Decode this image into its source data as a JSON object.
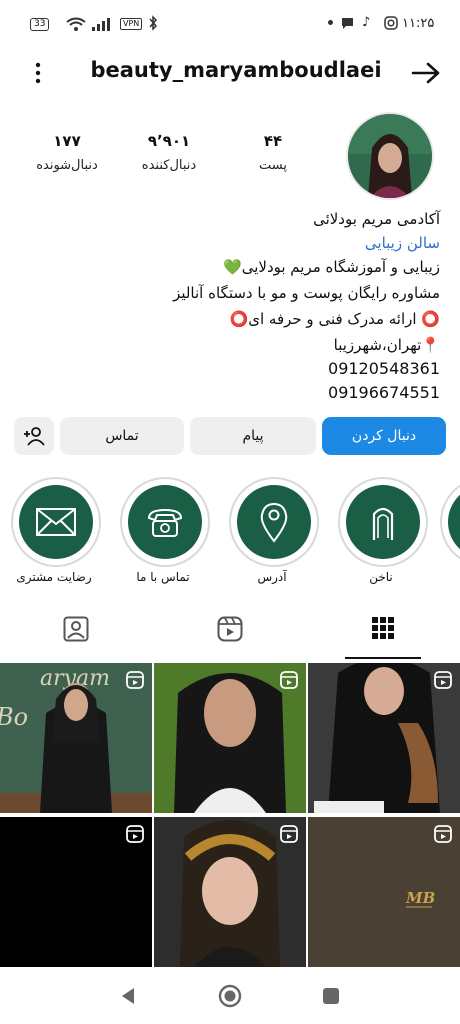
{
  "status_bar": {
    "battery": "33",
    "vpn": "VPN",
    "time": "۱۱:۲۵"
  },
  "header": {
    "username": "beauty_maryamboudlaei"
  },
  "stats": [
    {
      "value": "۴۴",
      "label": "پست"
    },
    {
      "value": "۹٬۹۰۱",
      "label": "دنبال‌کننده"
    },
    {
      "value": "۱۷۷",
      "label": "دنبال‌شونده"
    }
  ],
  "bio": {
    "name": "آکادمی مریم بودلائی",
    "category": "سالن زیبایی",
    "line1": "زیبایی و آموزشگاه مریم بودلایی💚",
    "line2": "مشاوره رایگان پوست و مو با دستگاه آنالیز",
    "line3": "⭕ ارائه مدرک فنی و حرفه ای⭕",
    "line4": "📍تهران،شهرزیبا",
    "phone1": "09120548361",
    "phone2": "09196674551"
  },
  "buttons": {
    "follow": "دنبال کردن",
    "message": "پیام",
    "contact": "تماس"
  },
  "highlights": [
    {
      "label": "ناخن",
      "icon": "nail-icon"
    },
    {
      "label": "آدرس",
      "icon": "location-pin-icon"
    },
    {
      "label": "تماس با ما",
      "icon": "telephone-icon"
    },
    {
      "label": "رضایت مشتری",
      "icon": "envelope-icon"
    }
  ],
  "colors": {
    "accent": "#1e88e5",
    "highlight_bg": "#1a5e46",
    "link": "#2f6fd0"
  }
}
